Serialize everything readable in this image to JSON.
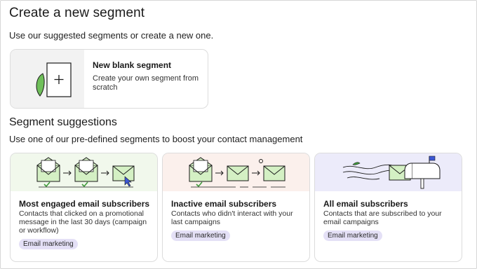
{
  "page": {
    "title": "Create a new segment",
    "intro": "Use our suggested segments or create a new one."
  },
  "blank_segment": {
    "title": "New blank segment",
    "description": "Create your own segment from scratch",
    "icon": "plus-document-icon"
  },
  "suggestions": {
    "title": "Segment suggestions",
    "subtitle": "Use one of our pre-defined segments to boost your contact management",
    "cards": [
      {
        "title": "Most engaged email subscribers",
        "description": "Contacts that clicked on a promotional message in the last 30 days (campaign or workflow)",
        "tag": "Email marketing",
        "hero_color": "#f1f8ec"
      },
      {
        "title": "Inactive email subscribers",
        "description": "Contacts who didn't interact with your last campaigns",
        "tag": "Email marketing",
        "hero_color": "#fbf0ec"
      },
      {
        "title": "All email subscribers",
        "description": "Contacts that are subscribed to your email campaigns",
        "tag": "Email marketing",
        "hero_color": "#ecebfa"
      }
    ]
  },
  "colors": {
    "envelope_fill": "#d4f0c4",
    "line": "#1a1a1a",
    "leaf": "#3f9a3b",
    "tag_bg": "#e4e0f6",
    "flag": "#3c57d6"
  }
}
